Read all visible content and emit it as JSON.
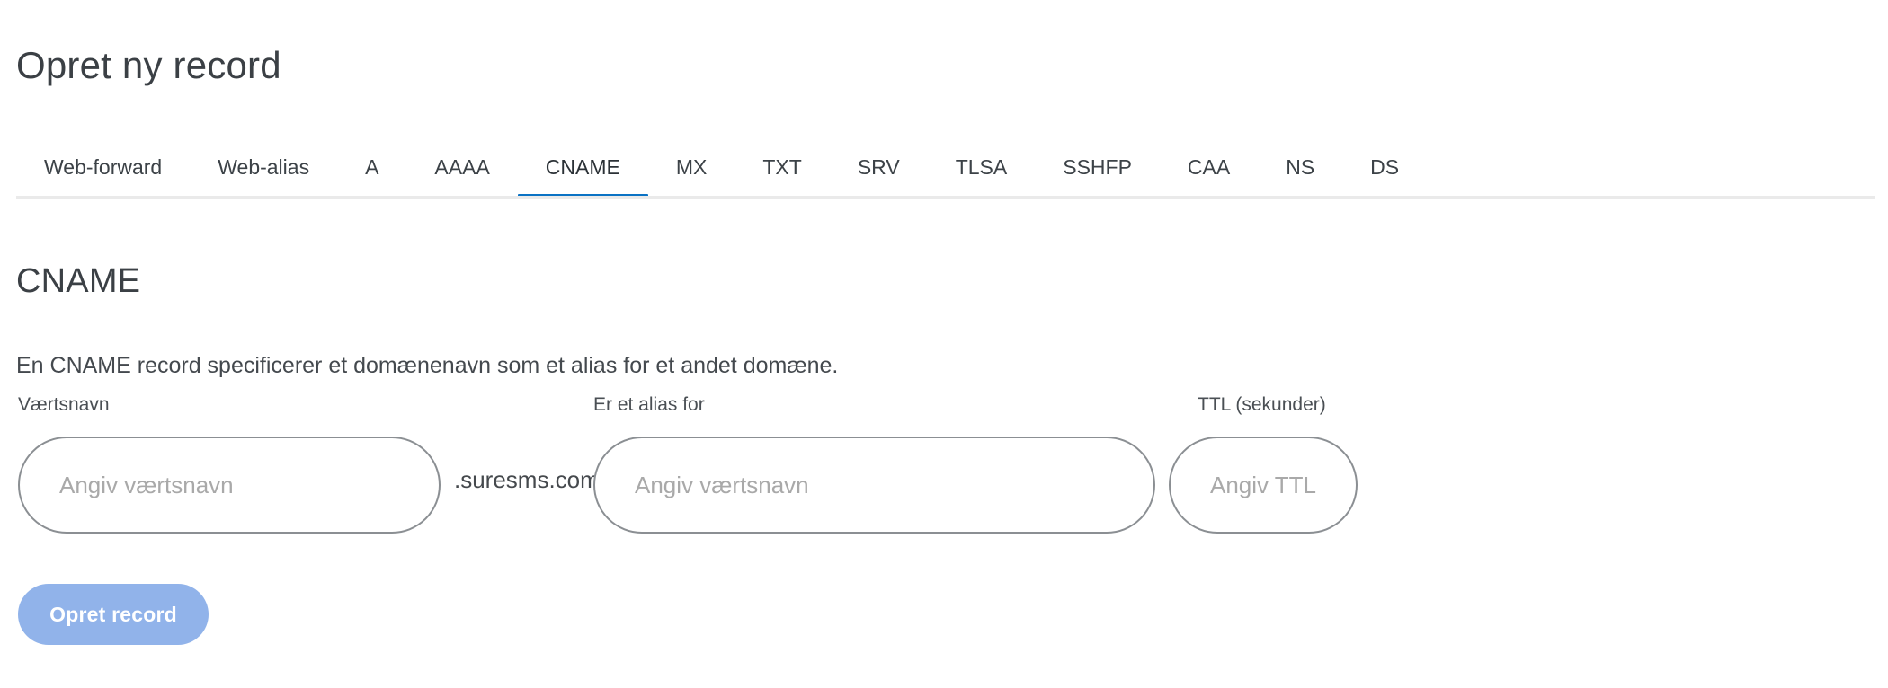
{
  "page": {
    "title": "Opret ny record"
  },
  "tabs": {
    "active_index": 4,
    "items": [
      {
        "label": "Web-forward"
      },
      {
        "label": "Web-alias"
      },
      {
        "label": "A"
      },
      {
        "label": "AAAA"
      },
      {
        "label": "CNAME"
      },
      {
        "label": "MX"
      },
      {
        "label": "TXT"
      },
      {
        "label": "SRV"
      },
      {
        "label": "TLSA"
      },
      {
        "label": "SSHFP"
      },
      {
        "label": "CAA"
      },
      {
        "label": "NS"
      },
      {
        "label": "DS"
      }
    ]
  },
  "record": {
    "heading": "CNAME",
    "description": "En CNAME record specificerer et domænenavn som et alias for et andet domæne."
  },
  "form": {
    "hostname": {
      "label": "Værtsnavn",
      "placeholder": "Angiv værtsnavn",
      "value": ""
    },
    "domain_suffix": ".suresms.com",
    "alias": {
      "label": "Er et alias for",
      "placeholder": "Angiv værtsnavn",
      "value": ""
    },
    "ttl": {
      "label": "TTL (sekunder)",
      "placeholder": "Angiv TTL",
      "value": ""
    },
    "submit_label": "Opret record"
  },
  "colors": {
    "accent": "#0a72c4",
    "button": "#91b3ea",
    "rule": "#eaeaea",
    "input_border": "#8b8f93",
    "placeholder": "#a9a9a9",
    "text": "#3b4045"
  }
}
